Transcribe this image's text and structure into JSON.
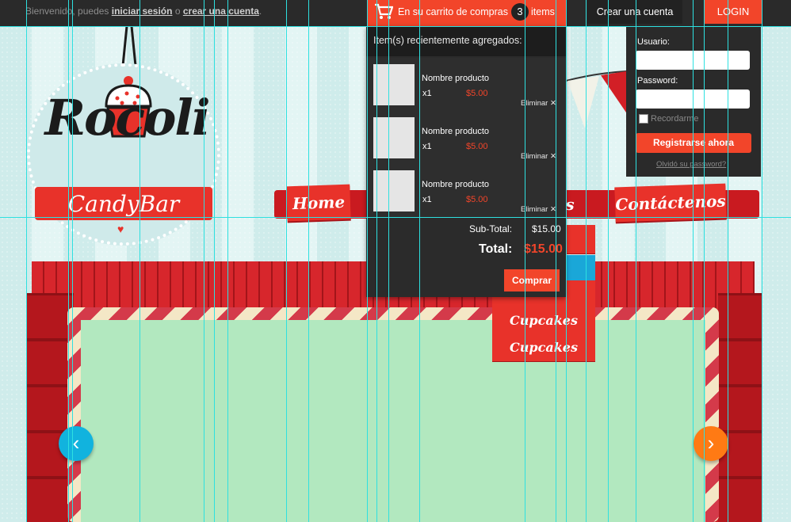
{
  "topbar": {
    "welcome_prefix": "Bienvenido, puedes",
    "login_link": "iniciar sesión",
    "or_text": "o",
    "register_link": "crear una cuenta",
    "cart_label": "En su carrito de compras",
    "cart_count": "3",
    "cart_items_word": "items",
    "create_account": "Crear una cuenta",
    "login": "LOGIN"
  },
  "cart": {
    "title": "Item(s) recientemente agregados:",
    "items": [
      {
        "name": "Nombre producto",
        "qty": "x1",
        "price": "$5.00",
        "remove": "Eliminar ✕"
      },
      {
        "name": "Nombre producto",
        "qty": "x1",
        "price": "$5.00",
        "remove": "Eliminar ✕"
      },
      {
        "name": "Nombre producto",
        "qty": "x1",
        "price": "$5.00",
        "remove": "Eliminar ✕"
      }
    ],
    "subtotal_label": "Sub-Total:",
    "subtotal_value": "$15.00",
    "total_label": "Total:",
    "total_value": "$15.00",
    "buy": "Comprar"
  },
  "login_panel": {
    "user_label": "Usuario:",
    "password_label": "Password:",
    "remember": "Recordarme",
    "register": "Registrarse ahora",
    "forgot": "Olvidó su password?"
  },
  "logo": {
    "title": "Rocoli",
    "subtitle": "CandyBar"
  },
  "nav": {
    "home": "Home",
    "contact": "Contáctenos",
    "partial": "os"
  },
  "dropdown": {
    "items": [
      "Cupcakes",
      "Cupcakes"
    ]
  },
  "slider": {
    "prev": "‹",
    "next": "›"
  },
  "colors": {
    "accent": "#f2452a",
    "dark": "#2a2a2a",
    "brick": "#c81e24",
    "screen": "#b2e8bf",
    "guide": "#2ee0e0"
  }
}
